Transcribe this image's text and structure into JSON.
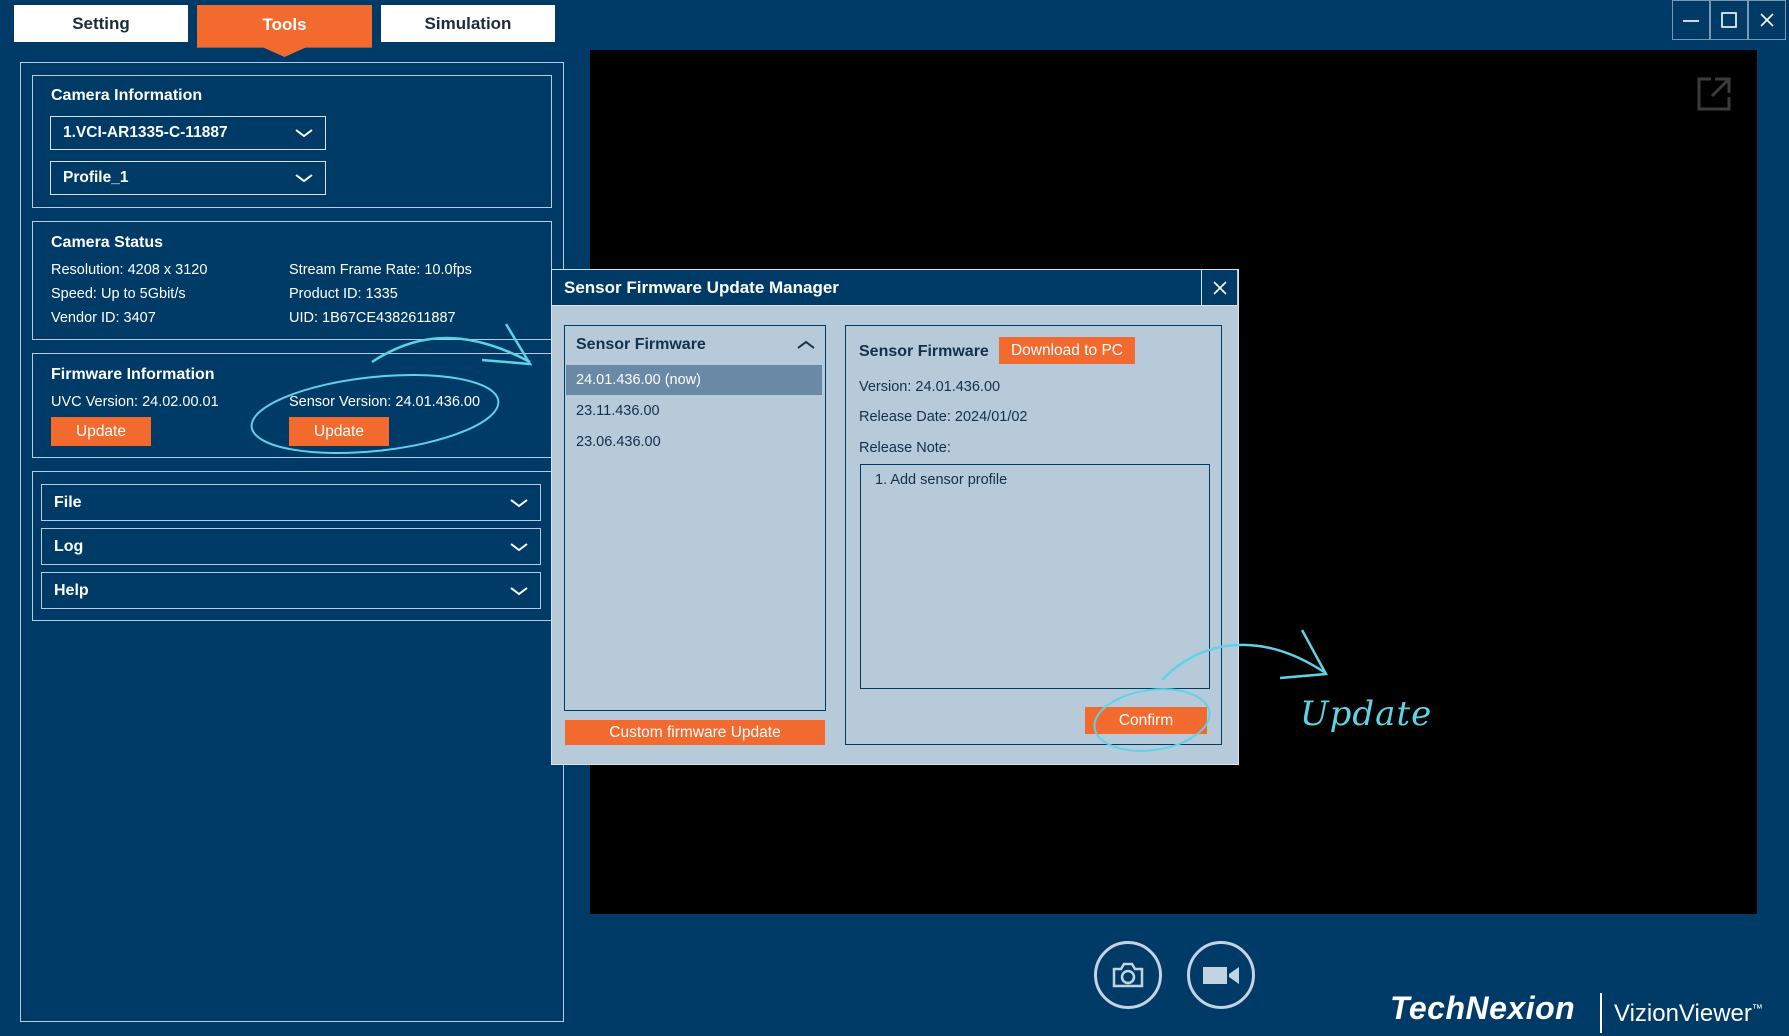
{
  "tabs": [
    {
      "label": "Setting",
      "active": false
    },
    {
      "label": "Tools",
      "active": true
    },
    {
      "label": "Simulation",
      "active": false
    }
  ],
  "camera_info": {
    "title": "Camera Information",
    "device": "1.VCI-AR1335-C-11887",
    "profile": "Profile_1"
  },
  "camera_status": {
    "title": "Camera Status",
    "resolution": "Resolution: 4208 x 3120",
    "frame_rate": "Stream Frame Rate: 10.0fps",
    "speed": "Speed: Up to 5Gbit/s",
    "product_id": "Product ID: 1335",
    "vendor_id": "Vendor ID: 3407",
    "uid": "UID: 1B67CE4382611887"
  },
  "firmware_info": {
    "title": "Firmware Information",
    "uvc_version": "UVC Version: 24.02.00.01",
    "sensor_version": "Sensor Version: 24.01.436.00",
    "update_label": "Update"
  },
  "accordions": [
    "File",
    "Log",
    "Help"
  ],
  "dialog": {
    "title": "Sensor Firmware Update Manager",
    "list_title": "Sensor Firmware",
    "versions": [
      "24.01.436.00 (now)",
      "23.11.436.00",
      "23.06.436.00"
    ],
    "custom_update": "Custom firmware Update",
    "detail_title": "Sensor Firmware",
    "download": "Download to PC",
    "version": "Version: 24.01.436.00",
    "release_date": "Release Date: 2024/01/02",
    "release_note_label": "Release Note:",
    "release_note": "1. Add sensor profile",
    "confirm": "Confirm"
  },
  "annotation": "Update",
  "brand": {
    "company": "TechNexion",
    "product": "VizionViewer",
    "tm": "™"
  },
  "colors": {
    "background": "#003a66",
    "accent": "#f26a2e",
    "dialog_bg": "#b6cad9",
    "annotation": "#5ed3e8"
  },
  "icons": [
    "minimize-icon",
    "maximize-icon",
    "close-icon",
    "popout-icon",
    "camera-icon",
    "video-icon",
    "chevron-down-icon",
    "chevron-up-icon"
  ]
}
